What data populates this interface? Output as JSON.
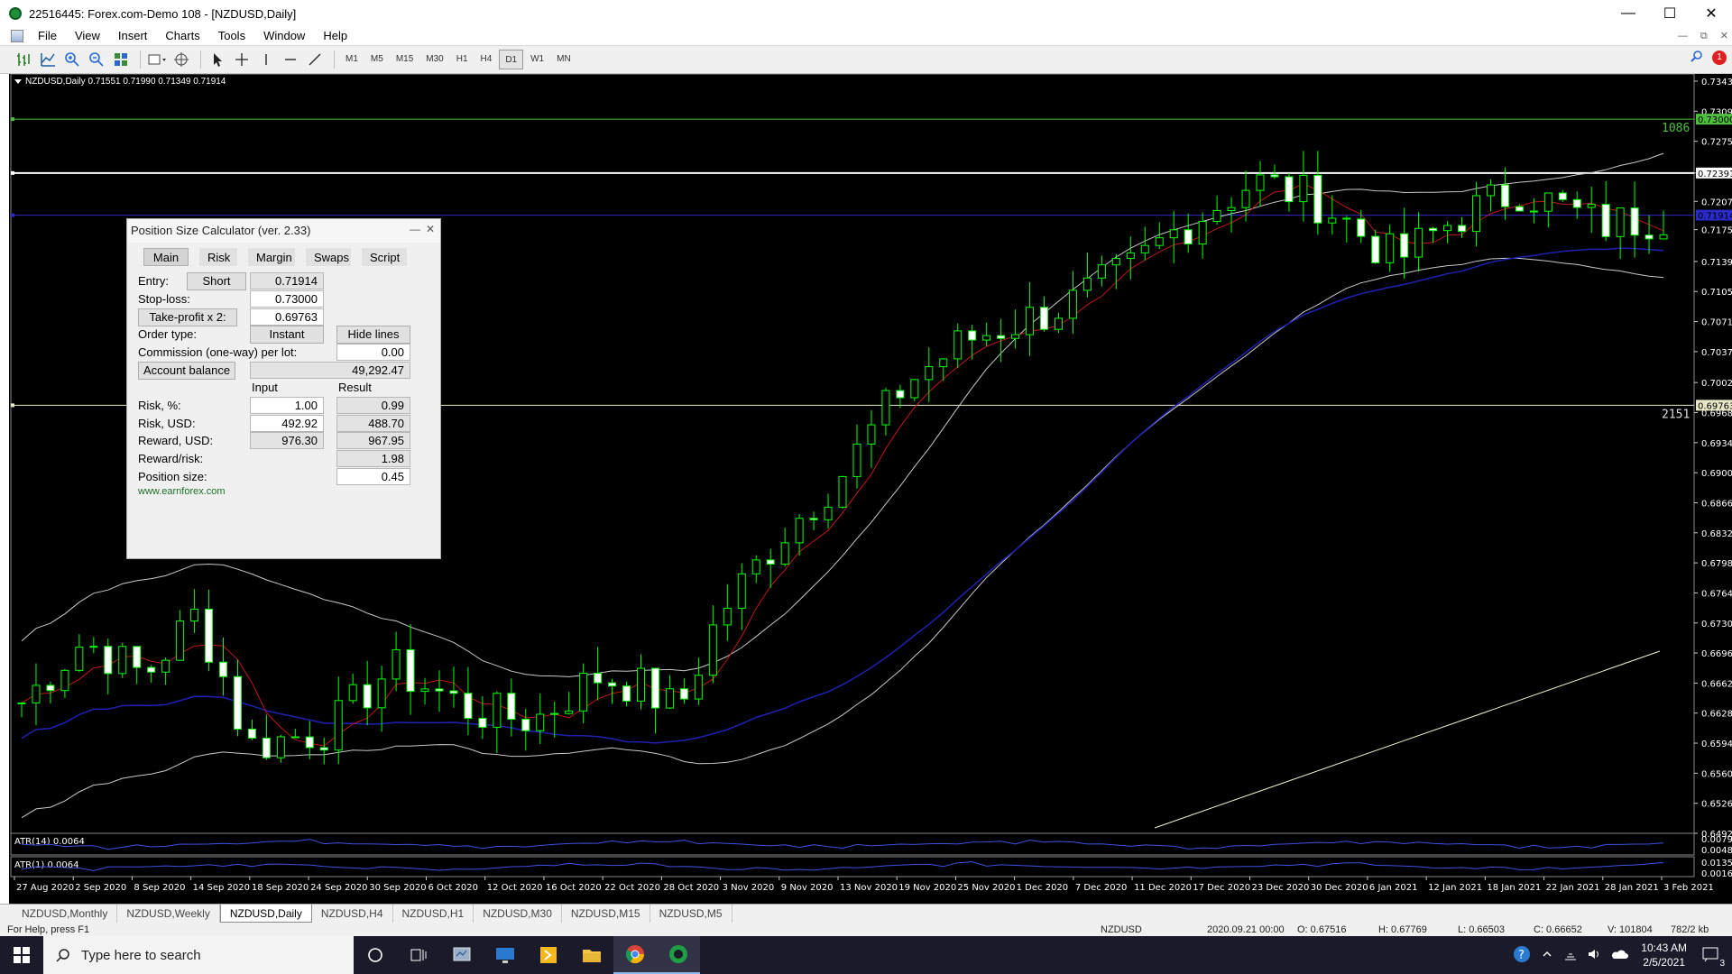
{
  "window": {
    "title": "22516445: Forex.com-Demo 108 - [NZDUSD,Daily]"
  },
  "menu": [
    "File",
    "View",
    "Insert",
    "Charts",
    "Tools",
    "Window",
    "Help"
  ],
  "timeframes": [
    "M1",
    "M5",
    "M15",
    "M30",
    "H1",
    "H4",
    "D1",
    "W1",
    "MN"
  ],
  "active_timeframe": "D1",
  "alerts_count": "1",
  "chart": {
    "caption": "NZDUSD,Daily  0.71551 0.71990 0.71349 0.71914",
    "price_labels": [
      "0.73430",
      "0.73090",
      "0.72750",
      "0.72391",
      "0.72070",
      "0.71750",
      "0.71390",
      "0.71050",
      "0.70710",
      "0.70370",
      "0.70020",
      "0.69680",
      "0.69340",
      "0.69000",
      "0.68660",
      "0.68320",
      "0.67980",
      "0.67640",
      "0.67300",
      "0.66960",
      "0.66620",
      "0.66280",
      "0.65940",
      "0.65600",
      "0.65260",
      "0.64920"
    ],
    "tagged_levels": {
      "tp_line": "0.73000",
      "white_line": "0.72391",
      "entry_line": "0.71914",
      "sl_line": "0.69763"
    },
    "line_annotations": {
      "upper": "1086",
      "lower": "2151"
    },
    "date_labels": [
      "27 Aug 2020",
      "2 Sep 2020",
      "8 Sep 2020",
      "14 Sep 2020",
      "18 Sep 2020",
      "24 Sep 2020",
      "30 Sep 2020",
      "6 Oct 2020",
      "12 Oct 2020",
      "16 Oct 2020",
      "22 Oct 2020",
      "28 Oct 2020",
      "3 Nov 2020",
      "9 Nov 2020",
      "13 Nov 2020",
      "19 Nov 2020",
      "25 Nov 2020",
      "1 Dec 2020",
      "7 Dec 2020",
      "11 Dec 2020",
      "17 Dec 2020",
      "23 Dec 2020",
      "30 Dec 2020",
      "6 Jan 2021",
      "12 Jan 2021",
      "18 Jan 2021",
      "22 Jan 2021",
      "28 Jan 2021",
      "3 Feb 2021"
    ],
    "indicator1": {
      "label": "ATR(14) 0.0064",
      "scale": [
        "0.0079",
        "0.0048"
      ]
    },
    "indicator2": {
      "label": "ATR(1) 0.0064",
      "scale": [
        "0.0135",
        "0.0016"
      ]
    },
    "colors": {
      "bull": "#000000",
      "bear": "#ffffff",
      "wick": "#00ff00",
      "ma_red": "#c01818",
      "ma_blue": "#2020b0",
      "bands": "#c8c8c8",
      "tp": "#4cbf3c",
      "sl": "#e8e8c8",
      "entry": "#2a2ac8",
      "trend": "#f0f0d0"
    }
  },
  "psc": {
    "title": "Position Size Calculator (ver. 2.33)",
    "tabs": [
      "Main",
      "Risk",
      "Margin",
      "Swaps",
      "Script"
    ],
    "active_tab": "Main",
    "entry_label": "Entry:",
    "direction": "Short",
    "entry_value": "0.71914",
    "sl_label": "Stop-loss:",
    "sl_value": "0.73000",
    "tp_button": "Take-profit x 2:",
    "tp_value": "0.69763",
    "order_type_label": "Order type:",
    "order_type": "Instant",
    "hide_lines": "Hide lines",
    "commission_label": "Commission (one-way) per lot:",
    "commission_value": "0.00",
    "account_button": "Account balance",
    "account_value": "49,292.47",
    "col_input": "Input",
    "col_result": "Result",
    "risk_pct_label": "Risk, %:",
    "risk_pct_input": "1.00",
    "risk_pct_result": "0.99",
    "risk_usd_label": "Risk, USD:",
    "risk_usd_input": "492.92",
    "risk_usd_result": "488.70",
    "reward_usd_label": "Reward, USD:",
    "reward_usd_input": "976.30",
    "reward_usd_result": "967.95",
    "rr_label": "Reward/risk:",
    "rr_result": "1.98",
    "pos_label": "Position size:",
    "pos_result": "0.45",
    "link": "www.earnforex.com"
  },
  "chart_tabs": [
    "NZDUSD,Monthly",
    "NZDUSD,Weekly",
    "NZDUSD,Daily",
    "NZDUSD,H4",
    "NZDUSD,H1",
    "NZDUSD,M30",
    "NZDUSD,M15",
    "NZDUSD,M5"
  ],
  "active_chart_tab": "NZDUSD,Daily",
  "status": {
    "help": "For Help, press F1",
    "symbol": "NZDUSD",
    "datetime": "2020.09.21 00:00",
    "open": "O: 0.67516",
    "high": "H: 0.67769",
    "low": "L: 0.66503",
    "close": "C: 0.66652",
    "volume": "V: 101804",
    "traffic": "782/2 kb"
  },
  "taskbar": {
    "search_placeholder": "Type here to search",
    "time": "10:43 AM",
    "date": "2/5/2021",
    "notifications": "3"
  }
}
